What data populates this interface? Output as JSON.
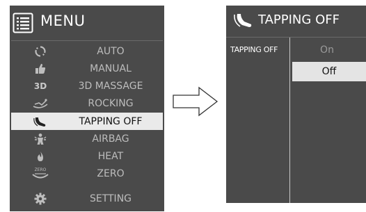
{
  "menu": {
    "title": "MENU",
    "items": [
      {
        "label": "AUTO",
        "icon": "refresh-icon",
        "selected": false
      },
      {
        "label": "MANUAL",
        "icon": "thumbs-up-icon",
        "selected": false
      },
      {
        "label": "3D MASSAGE",
        "icon": "3d-icon",
        "icon_text": "3D",
        "selected": false
      },
      {
        "label": "ROCKING",
        "icon": "rocking-icon",
        "selected": false
      },
      {
        "label": "TAPPING OFF",
        "icon": "tapping-hand-icon",
        "selected": true
      },
      {
        "label": "AIRBAG",
        "icon": "airbag-icon",
        "selected": false
      },
      {
        "label": "HEAT",
        "icon": "flame-icon",
        "selected": false
      },
      {
        "label": "ZERO",
        "icon": "zero-gravity-icon",
        "icon_text": "ZERO",
        "selected": false
      },
      {
        "label": "SETTING",
        "icon": "gear-icon",
        "selected": false
      }
    ]
  },
  "tapping": {
    "title": "TAPPING OFF",
    "label": "TAPPING OFF",
    "options": [
      "On",
      "Off"
    ],
    "selected": "Off"
  },
  "colors": {
    "panel_bg": "#4a4a4a",
    "highlight_bg": "#eaeaea",
    "text_dim": "#bdbdbd",
    "text_white": "#ffffff"
  }
}
